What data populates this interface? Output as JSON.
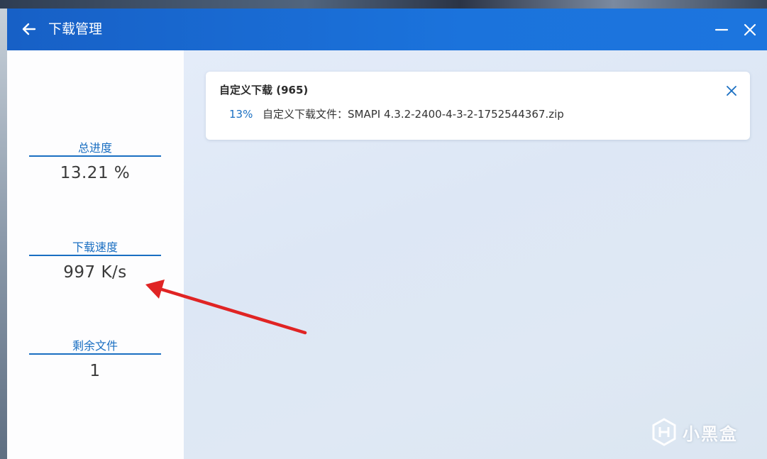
{
  "window": {
    "title": "下载管理"
  },
  "sidebar": {
    "total_progress": {
      "label": "总进度",
      "value": "13.21 %"
    },
    "download_speed": {
      "label": "下载速度",
      "value": "997 K/s"
    },
    "remaining_files": {
      "label": "剩余文件",
      "value": "1"
    }
  },
  "task_card": {
    "title": "自定义下载 (965)",
    "items": [
      {
        "percent": "13%",
        "name": "自定义下载文件：SMAPI 4.3.2-2400-4-3-2-1752544367.zip",
        "progress": 0.13
      }
    ]
  },
  "watermark": {
    "text": "小黑盒",
    "icon": "heybox-logo-icon"
  },
  "colors": {
    "titlebar": "#1b6fd8",
    "accent": "#1a6fc2",
    "arrow": "#e02424"
  },
  "icons": {
    "back": "arrow-left-icon",
    "minimize": "minimize-icon",
    "close": "close-icon",
    "card_close": "close-icon"
  }
}
